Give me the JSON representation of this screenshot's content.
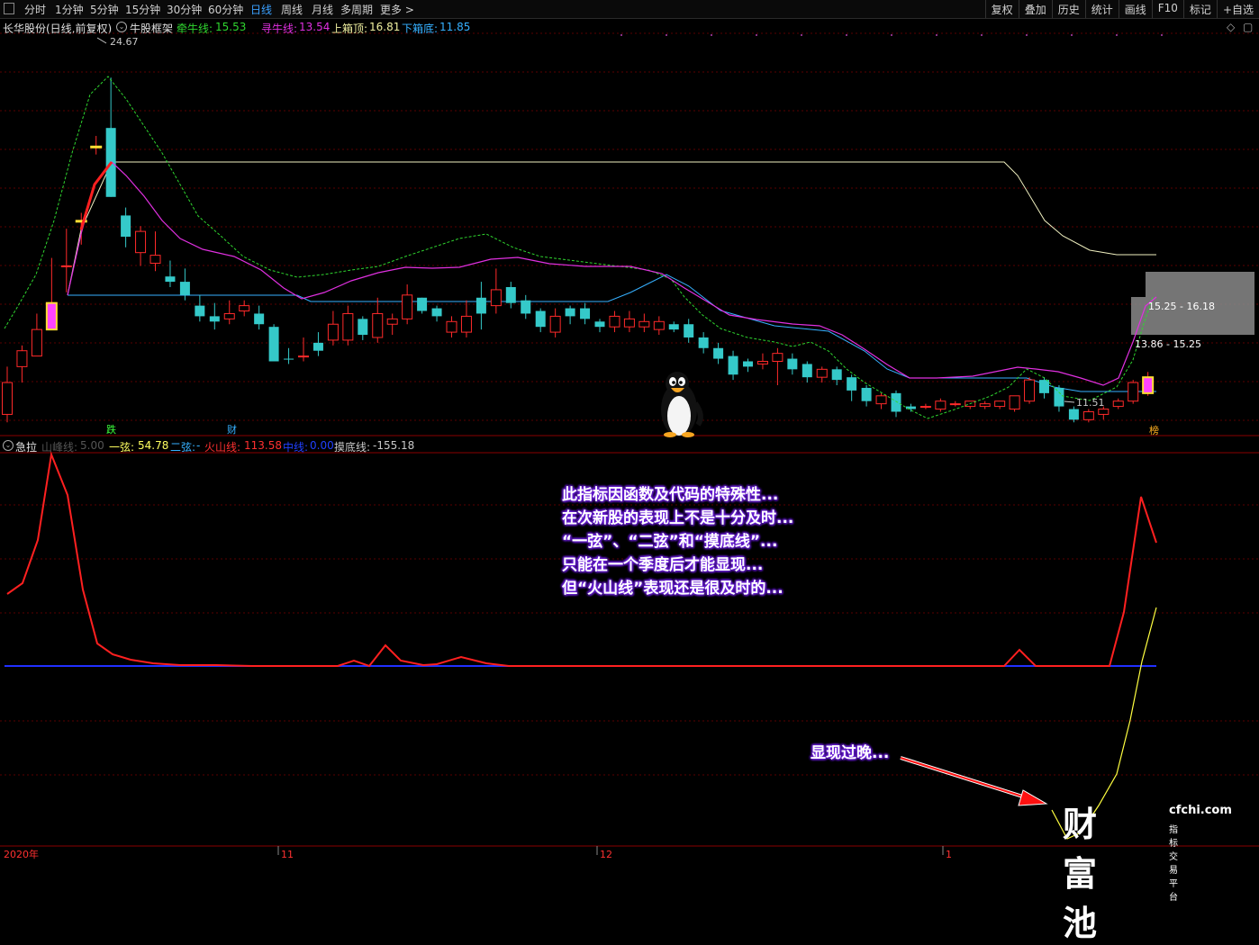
{
  "toolbar": {
    "periods": [
      "分时",
      "1分钟",
      "5分钟",
      "15分钟",
      "30分钟",
      "60分钟",
      "日线",
      "周线",
      "月线",
      "多周期",
      "更多 >"
    ],
    "active": "日线",
    "right": [
      "复权",
      "叠加",
      "历史",
      "统计",
      "画线",
      "F10",
      "标记",
      "+自选"
    ]
  },
  "main_status": {
    "stock": "长华股份(日线,前复权)",
    "indicator": "牛股框架",
    "qianniu_label": "牵牛线: ",
    "qianniu_value": "15.53",
    "xunniu_label": "寻牛线: ",
    "xunniu_value": "13.54",
    "upper_label": "上箱顶: ",
    "upper_value": "16.81",
    "lower_label": "下箱底: ",
    "lower_value": "11.85"
  },
  "sub_status": {
    "indicator": "急拉",
    "shanfeng_label": "山峰线: ",
    "shanfeng_value": "5.00",
    "yixian_label": "一弦: ",
    "yixian_value": "54.78",
    "erxian_label": "二弦: ",
    "erxian_value": "-",
    "huoshan_label": "火山线: ",
    "huoshan_value": "113.58",
    "zhongxian_label": "中线: ",
    "zhongxian_value": "0.00",
    "modi_label": "摸底线: ",
    "modi_value": "-155.18"
  },
  "chart_labels": {
    "high": "24.67",
    "low": "11.51",
    "box_upper": "15.25 - 16.18",
    "box_lower": "13.86 - 15.25",
    "mark_die": "跌",
    "mark_cai": "财",
    "mark_bang": "榜"
  },
  "xaxis": [
    "2020年",
    "11",
    "12",
    "1"
  ],
  "annotation": {
    "lines": [
      "此指标因函数及代码的特殊性...",
      "在次新股的表现上不是十分及时...",
      "“一弦”、“二弦”和“摸底线”...",
      "只能在一个季度后才能显现...",
      "但“火山线”表现还是很及时的..."
    ],
    "late": "显现过晚..."
  },
  "watermark": {
    "big": "财富池",
    "url": "cfchi.com",
    "sub": "指标交易平台"
  },
  "chart_data": {
    "type": "candlestick",
    "price_scale": {
      "min": 11.0,
      "max": 26.0
    },
    "candles": [
      [
        13.0,
        13.6,
        11.8,
        11.5,
        "up"
      ],
      [
        14.2,
        14.4,
        13.6,
        13.0,
        "up"
      ],
      [
        15.0,
        15.6,
        14.0,
        14.0,
        "up"
      ],
      [
        16.0,
        17.7,
        15.0,
        15.0,
        "spike"
      ],
      [
        17.4,
        18.8,
        17.4,
        16.4,
        "up"
      ],
      [
        19.1,
        19.4,
        19.1,
        18.2,
        "spike"
      ],
      [
        21.9,
        22.3,
        21.9,
        21.6,
        "spike"
      ],
      [
        22.6,
        24.5,
        20.0,
        20.0,
        "down"
      ],
      [
        19.3,
        19.6,
        18.5,
        18.1,
        "down"
      ],
      [
        18.7,
        18.9,
        17.9,
        17.4,
        "up"
      ],
      [
        17.8,
        18.7,
        17.5,
        17.2,
        "up"
      ],
      [
        17.0,
        17.6,
        16.8,
        16.6,
        "down"
      ],
      [
        16.8,
        17.3,
        16.3,
        16.1,
        "down"
      ],
      [
        15.9,
        16.3,
        15.5,
        15.3,
        "down"
      ],
      [
        15.5,
        16.0,
        15.3,
        15.0,
        "down"
      ],
      [
        15.6,
        16.1,
        15.4,
        15.2,
        "up"
      ],
      [
        15.9,
        16.1,
        15.7,
        15.5,
        "up"
      ],
      [
        15.6,
        15.9,
        15.2,
        15.0,
        "down"
      ],
      [
        15.1,
        15.2,
        13.8,
        13.8,
        "down"
      ],
      [
        13.9,
        14.3,
        13.9,
        13.7,
        "down"
      ],
      [
        14.0,
        14.7,
        14.0,
        13.8,
        "up"
      ],
      [
        14.5,
        14.9,
        14.2,
        14.0,
        "down"
      ],
      [
        15.2,
        15.7,
        14.6,
        14.4,
        "up"
      ],
      [
        15.6,
        15.9,
        14.6,
        14.4,
        "up"
      ],
      [
        15.4,
        15.5,
        14.8,
        14.6,
        "down"
      ],
      [
        15.6,
        16.2,
        14.7,
        14.5,
        "up"
      ],
      [
        15.4,
        15.6,
        15.2,
        14.8,
        "up"
      ],
      [
        16.3,
        16.7,
        15.4,
        15.2,
        "up"
      ],
      [
        16.2,
        16.2,
        15.7,
        15.6,
        "down"
      ],
      [
        15.8,
        15.9,
        15.5,
        15.3,
        "down"
      ],
      [
        15.3,
        15.5,
        14.9,
        14.7,
        "up"
      ],
      [
        15.5,
        16.1,
        14.9,
        14.7,
        "up"
      ],
      [
        16.2,
        16.8,
        15.6,
        15.0,
        "down"
      ],
      [
        16.5,
        17.3,
        15.9,
        15.6,
        "up"
      ],
      [
        16.6,
        16.8,
        16.0,
        15.8,
        "down"
      ],
      [
        16.1,
        16.3,
        15.6,
        15.4,
        "down"
      ],
      [
        15.7,
        15.8,
        15.1,
        14.9,
        "down"
      ],
      [
        15.5,
        15.8,
        14.9,
        14.7,
        "up"
      ],
      [
        15.8,
        15.9,
        15.5,
        15.2,
        "down"
      ],
      [
        15.8,
        16.0,
        15.4,
        15.2,
        "down"
      ],
      [
        15.3,
        15.4,
        15.1,
        14.9,
        "down"
      ],
      [
        15.5,
        15.7,
        15.1,
        14.9,
        "up"
      ],
      [
        15.4,
        15.7,
        15.1,
        14.9,
        "up"
      ],
      [
        15.3,
        15.6,
        15.1,
        14.9,
        "up"
      ],
      [
        15.3,
        15.5,
        15.0,
        14.8,
        "up"
      ],
      [
        15.2,
        15.3,
        15.0,
        14.9,
        "down"
      ],
      [
        15.2,
        15.4,
        14.7,
        14.5,
        "down"
      ],
      [
        14.7,
        14.9,
        14.3,
        14.1,
        "down"
      ],
      [
        14.3,
        14.5,
        13.9,
        13.7,
        "down"
      ],
      [
        14.0,
        14.2,
        13.3,
        13.1,
        "down"
      ],
      [
        13.8,
        13.9,
        13.6,
        13.4,
        "down"
      ],
      [
        13.8,
        14.1,
        13.7,
        13.5,
        "up"
      ],
      [
        14.1,
        14.3,
        13.8,
        12.9,
        "up"
      ],
      [
        13.9,
        14.1,
        13.5,
        13.3,
        "down"
      ],
      [
        13.7,
        13.8,
        13.2,
        13.0,
        "down"
      ],
      [
        13.5,
        13.6,
        13.2,
        13.0,
        "up"
      ],
      [
        13.5,
        13.6,
        13.1,
        12.9,
        "down"
      ],
      [
        13.2,
        13.3,
        12.7,
        12.3,
        "down"
      ],
      [
        12.8,
        12.9,
        12.3,
        12.1,
        "down"
      ],
      [
        12.5,
        12.6,
        12.2,
        12.0,
        "up"
      ],
      [
        12.6,
        12.7,
        11.9,
        11.7,
        "down"
      ],
      [
        12.1,
        12.2,
        12.0,
        11.9,
        "down"
      ],
      [
        12.1,
        12.2,
        12.1,
        12.0,
        "up"
      ],
      [
        12.3,
        12.4,
        12.0,
        11.9,
        "up"
      ],
      [
        12.2,
        12.3,
        12.2,
        12.1,
        "up"
      ],
      [
        12.3,
        12.3,
        12.1,
        12.0,
        "up"
      ],
      [
        12.2,
        12.3,
        12.1,
        12.0,
        "up"
      ],
      [
        12.3,
        12.3,
        12.1,
        12.0,
        "up"
      ],
      [
        12.5,
        12.5,
        12.0,
        11.9,
        "up"
      ],
      [
        13.1,
        13.2,
        12.3,
        12.2,
        "up"
      ],
      [
        13.1,
        13.2,
        12.6,
        12.4,
        "down"
      ],
      [
        12.8,
        12.9,
        12.1,
        11.9,
        "down"
      ],
      [
        12.0,
        12.1,
        11.6,
        11.5,
        "down"
      ],
      [
        11.9,
        12.0,
        11.6,
        11.5,
        "up"
      ],
      [
        12.0,
        12.1,
        11.8,
        11.6,
        "up"
      ],
      [
        12.3,
        12.4,
        12.1,
        12.0,
        "up"
      ],
      [
        13.0,
        13.1,
        12.3,
        12.2,
        "up"
      ],
      [
        13.2,
        13.4,
        12.6,
        12.5,
        "spike"
      ]
    ]
  }
}
